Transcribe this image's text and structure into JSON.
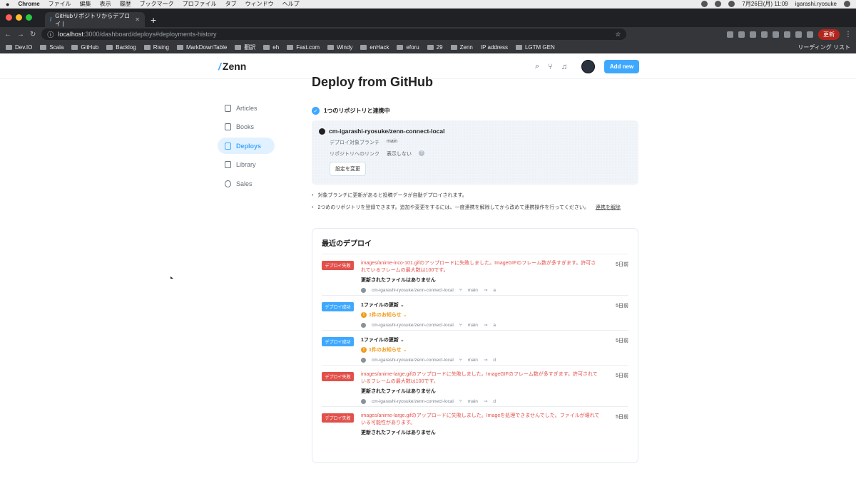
{
  "menubar": {
    "app": "Chrome",
    "items": [
      "ファイル",
      "編集",
      "表示",
      "履歴",
      "ブックマーク",
      "プロファイル",
      "タブ",
      "ウィンドウ",
      "ヘルプ"
    ],
    "datetime": "7月26日(月) 11:09",
    "user": "igarashi.ryosuke"
  },
  "browser": {
    "tab_title": "GitHubリポジトリからデプロイ |",
    "url_host": "localhost",
    "url_path": ":3000/dashboard/deploys#deployments-history",
    "update_label": "更新",
    "bookmarks": [
      "Dev.IO",
      "Scala",
      "GitHub",
      "Backlog",
      "Rising",
      "MarkDownTable",
      "翻訳",
      "eh",
      "Fast.com",
      "Windy",
      "enHack",
      "eforu",
      "29",
      "Zenn",
      "IP address",
      "LGTM GEN"
    ],
    "reading_list": "リーディング リスト"
  },
  "header": {
    "logo": "Zenn",
    "add_new": "Add new"
  },
  "sidebar": {
    "items": [
      {
        "label": "Articles",
        "active": false
      },
      {
        "label": "Books",
        "active": false
      },
      {
        "label": "Deploys",
        "active": true
      },
      {
        "label": "Library",
        "active": false
      },
      {
        "label": "Sales",
        "active": false
      }
    ]
  },
  "main": {
    "title": "Deploy from GitHub",
    "linked_status": "1つのリポジトリと連携中",
    "repo": {
      "name": "cm-igarashi-ryosuke/zenn-connect-local",
      "branch_label": "デプロイ対象ブランチ",
      "branch": "main",
      "link_label": "リポジトリへのリンク",
      "link_value": "表示しない",
      "help": "?",
      "change_button": "設定を変更"
    },
    "notes": [
      "対象ブランチに更新があると投稿データが自動デプロイされます。",
      "2つめのリポジトリを登録できます。追加や変更をするには、一度連携を解除してから改めて連携操作を行ってください。"
    ],
    "unlink_label": "連携を解除"
  },
  "deploys": {
    "title": "最近のデプロイ",
    "items": [
      {
        "status": "デプロイ失敗",
        "kind": "err",
        "message": "images/anime-inco-101.gifのアップロードに失敗しました。ImageGIFのフレーム数が多すぎます。許可されているフレームの最大数は100です。",
        "detail": "更新されたファイルはありません",
        "repo": "cm-igarashi-ryosuke/zenn-connect-local",
        "branch": "main",
        "commit": "a",
        "when": "5日前"
      },
      {
        "status": "デプロイ成功",
        "kind": "ok",
        "title": "1ファイルの更新 ⌄",
        "notice": "1件のお知らせ ⌄",
        "repo": "cm-igarashi-ryosuke/zenn-connect-local",
        "branch": "main",
        "commit": "a",
        "when": "5日前"
      },
      {
        "status": "デプロイ成功",
        "kind": "ok",
        "title": "1ファイルの更新 ⌄",
        "notice": "1件のお知らせ ⌄",
        "repo": "cm-igarashi-ryosuke/zenn-connect-local",
        "branch": "main",
        "commit": "d",
        "when": "5日前"
      },
      {
        "status": "デプロイ失敗",
        "kind": "err",
        "message": "images/anime-large.gifのアップロードに失敗しました。ImageGIFのフレーム数が多すぎます。許可されているフレームの最大数は100です。",
        "detail": "更新されたファイルはありません",
        "repo": "cm-igarashi-ryosuke/zenn-connect-local",
        "branch": "main",
        "commit": "d",
        "when": "5日前"
      },
      {
        "status": "デプロイ失敗",
        "kind": "err",
        "message": "images/anime-large.gifのアップロードに失敗しました。Imageを処理できませんでした。ファイルが壊れている可能性があります。",
        "detail": "更新されたファイルはありません",
        "when": "5日前"
      }
    ]
  },
  "colors": {
    "accent": "#3ea8ff",
    "error": "#e2504b",
    "warning": "#f09b1a"
  }
}
